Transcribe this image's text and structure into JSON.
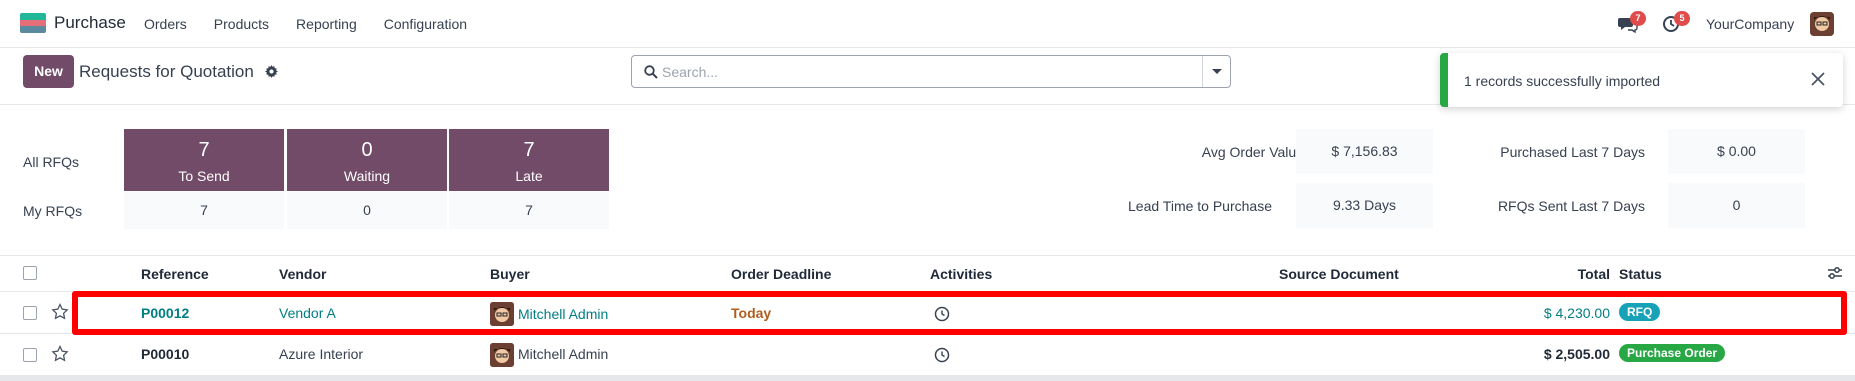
{
  "app": {
    "name": "Purchase",
    "menu": [
      "Orders",
      "Products",
      "Reporting",
      "Configuration"
    ],
    "messages_count": "7",
    "activities_count": "5",
    "company": "YourCompany"
  },
  "control": {
    "new_label": "New",
    "title": "Requests for Quotation",
    "search_placeholder": "Search..."
  },
  "toast": {
    "message": "1 records successfully imported",
    "accent_color": "#28a745"
  },
  "dashboard": {
    "all_label": "All RFQs",
    "my_label": "My RFQs",
    "tiles": [
      {
        "count": "7",
        "label": "To Send",
        "mine": "7"
      },
      {
        "count": "0",
        "label": "Waiting",
        "mine": "0"
      },
      {
        "count": "7",
        "label": "Late",
        "mine": "7"
      }
    ],
    "kpis": {
      "avg_order_value_label": "Avg Order Value",
      "avg_order_value": "$ 7,156.83",
      "purchased_last_7_label": "Purchased Last 7 Days",
      "purchased_last_7": "$ 0.00",
      "lead_time_label": "Lead Time to Purchase",
      "lead_time": "9.33 Days",
      "rfqs_sent_label": "RFQs Sent Last 7 Days",
      "rfqs_sent": "0"
    }
  },
  "table": {
    "headers": {
      "reference": "Reference",
      "vendor": "Vendor",
      "buyer": "Buyer",
      "deadline": "Order Deadline",
      "activities": "Activities",
      "source": "Source Document",
      "total": "Total",
      "status": "Status"
    },
    "rows": [
      {
        "reference": "P00012",
        "vendor": "Vendor A",
        "buyer": "Mitchell Admin",
        "deadline": "Today",
        "source": "",
        "total": "$ 4,230.00",
        "status": "RFQ",
        "status_color": "#17a2b8"
      },
      {
        "reference": "P00010",
        "vendor": "Azure Interior",
        "buyer": "Mitchell Admin",
        "deadline": "",
        "source": "",
        "total": "$ 2,505.00",
        "status": "Purchase Order",
        "status_color": "#28a745"
      }
    ]
  },
  "colors": {
    "brand": "#714b67",
    "link": "#017e84",
    "deadline_warning": "#b05c1c",
    "highlight": "#ff0000"
  }
}
